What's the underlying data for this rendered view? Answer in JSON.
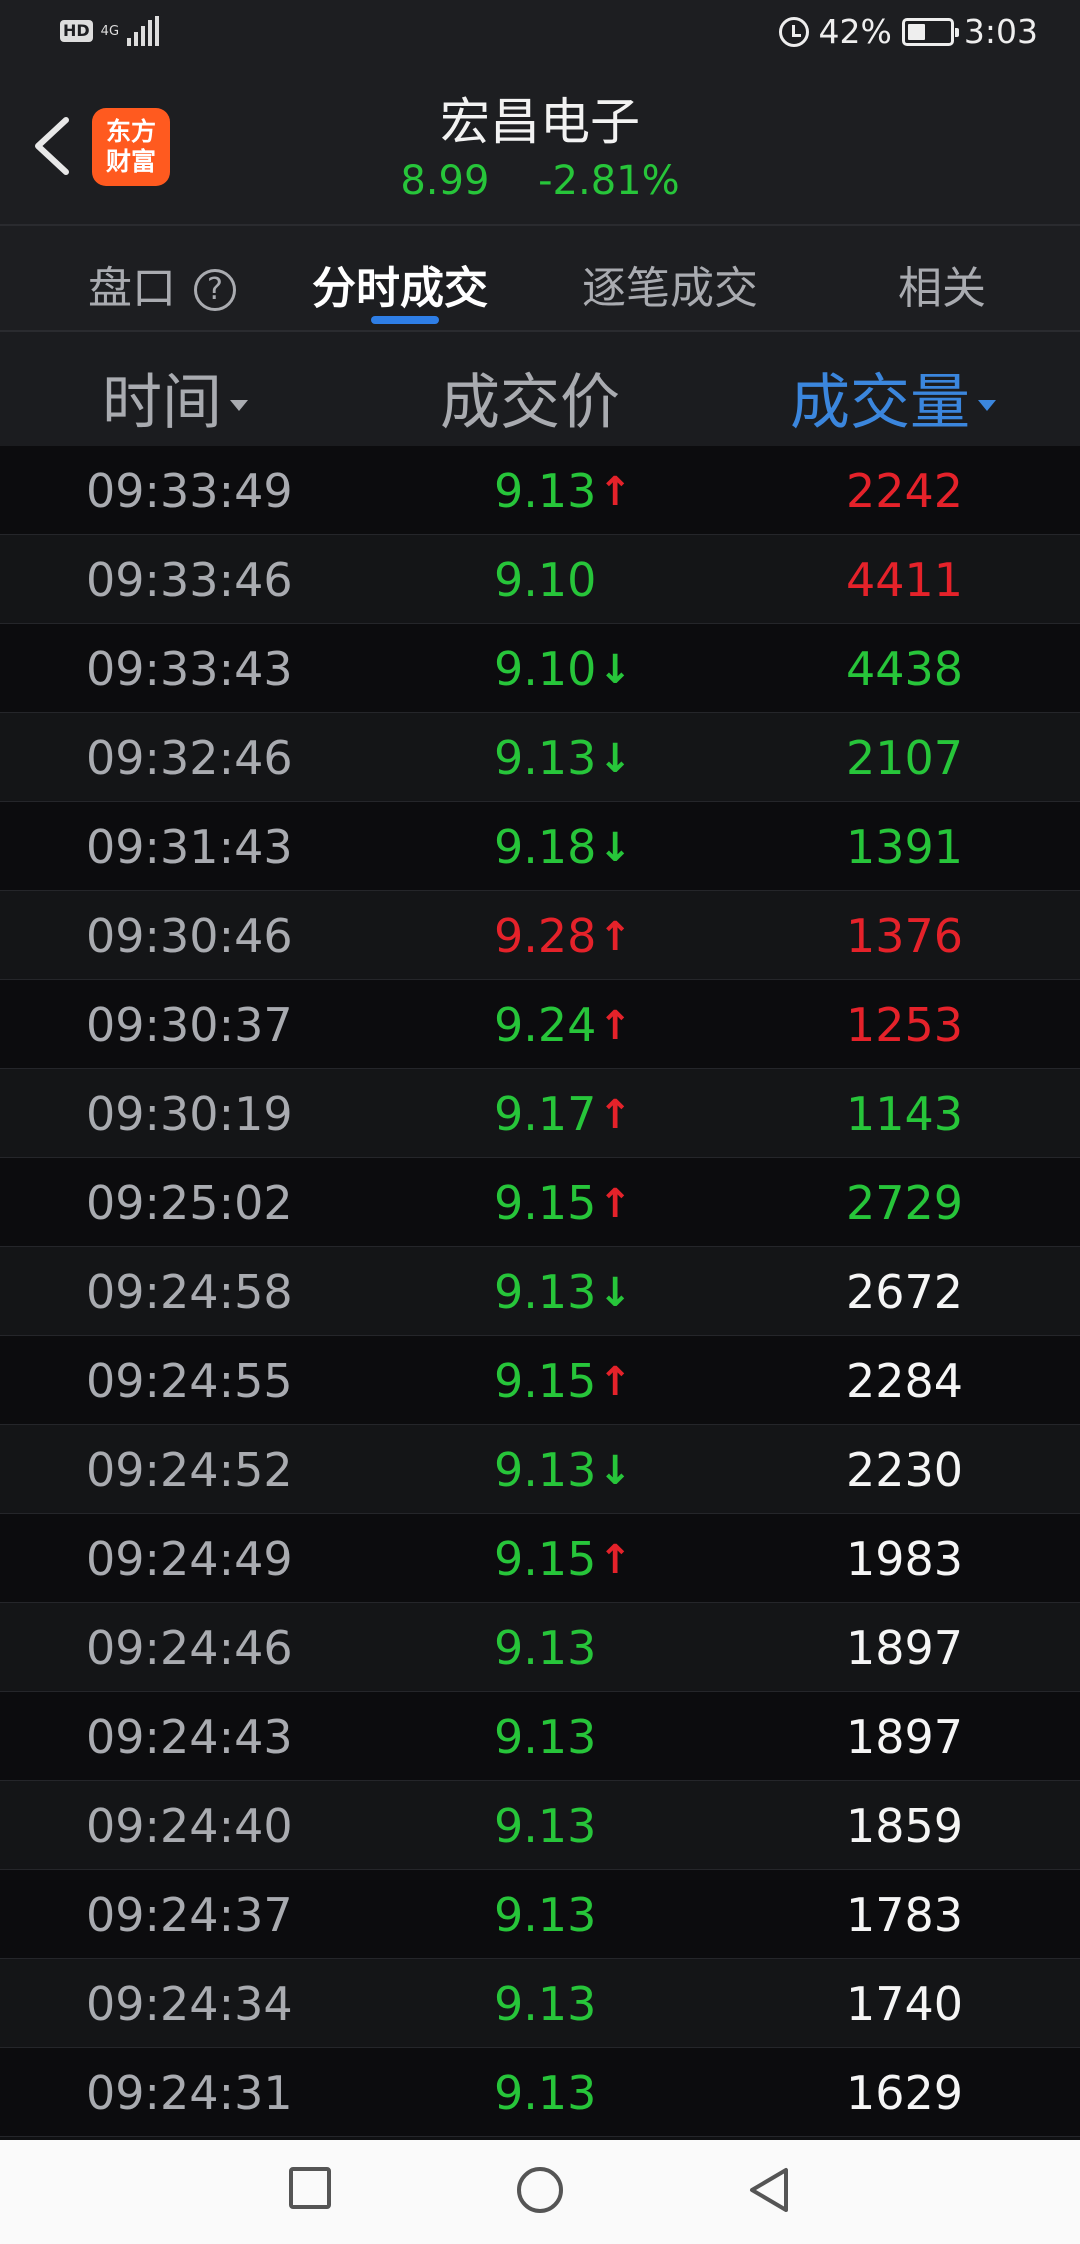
{
  "status_bar": {
    "hd": "HD",
    "network": "4G",
    "battery_percent": "42%",
    "battery_level": 0.42,
    "time": "3:03"
  },
  "header": {
    "logo_line1": "东方",
    "logo_line2": "财富",
    "stock_name": "宏昌电子",
    "price": "8.99",
    "change_percent": "-2.81%",
    "quote_color": "#27c53a"
  },
  "tabs": [
    {
      "label": "盘口",
      "active": false
    },
    {
      "label": "分时成交",
      "active": true
    },
    {
      "label": "逐笔成交",
      "active": false
    },
    {
      "label": "相关",
      "active": false
    }
  ],
  "help_symbol": "?",
  "columns": {
    "time": "时间",
    "price": "成交价",
    "volume": "成交量"
  },
  "colors": {
    "up": "#e5222a",
    "down": "#27c53a",
    "neutral": "#f5f5f5",
    "accent": "#2e7ee6"
  },
  "trades": [
    {
      "time": "09:33:49",
      "price": "9.13",
      "arrow": "up",
      "price_color": "green",
      "volume": "2242",
      "volume_color": "red"
    },
    {
      "time": "09:33:46",
      "price": "9.10",
      "arrow": "",
      "price_color": "green",
      "volume": "4411",
      "volume_color": "red"
    },
    {
      "time": "09:33:43",
      "price": "9.10",
      "arrow": "down",
      "price_color": "green",
      "volume": "4438",
      "volume_color": "green"
    },
    {
      "time": "09:32:46",
      "price": "9.13",
      "arrow": "down",
      "price_color": "green",
      "volume": "2107",
      "volume_color": "green"
    },
    {
      "time": "09:31:43",
      "price": "9.18",
      "arrow": "down",
      "price_color": "green",
      "volume": "1391",
      "volume_color": "green"
    },
    {
      "time": "09:30:46",
      "price": "9.28",
      "arrow": "up",
      "price_color": "red",
      "volume": "1376",
      "volume_color": "red"
    },
    {
      "time": "09:30:37",
      "price": "9.24",
      "arrow": "up",
      "price_color": "green",
      "volume": "1253",
      "volume_color": "red"
    },
    {
      "time": "09:30:19",
      "price": "9.17",
      "arrow": "up",
      "price_color": "green",
      "volume": "1143",
      "volume_color": "green"
    },
    {
      "time": "09:25:02",
      "price": "9.15",
      "arrow": "up",
      "price_color": "green",
      "volume": "2729",
      "volume_color": "green"
    },
    {
      "time": "09:24:58",
      "price": "9.13",
      "arrow": "down",
      "price_color": "green",
      "volume": "2672",
      "volume_color": "white"
    },
    {
      "time": "09:24:55",
      "price": "9.15",
      "arrow": "up",
      "price_color": "green",
      "volume": "2284",
      "volume_color": "white"
    },
    {
      "time": "09:24:52",
      "price": "9.13",
      "arrow": "down",
      "price_color": "green",
      "volume": "2230",
      "volume_color": "white"
    },
    {
      "time": "09:24:49",
      "price": "9.15",
      "arrow": "up",
      "price_color": "green",
      "volume": "1983",
      "volume_color": "white"
    },
    {
      "time": "09:24:46",
      "price": "9.13",
      "arrow": "",
      "price_color": "green",
      "volume": "1897",
      "volume_color": "white"
    },
    {
      "time": "09:24:43",
      "price": "9.13",
      "arrow": "",
      "price_color": "green",
      "volume": "1897",
      "volume_color": "white"
    },
    {
      "time": "09:24:40",
      "price": "9.13",
      "arrow": "",
      "price_color": "green",
      "volume": "1859",
      "volume_color": "white"
    },
    {
      "time": "09:24:37",
      "price": "9.13",
      "arrow": "",
      "price_color": "green",
      "volume": "1783",
      "volume_color": "white"
    },
    {
      "time": "09:24:34",
      "price": "9.13",
      "arrow": "",
      "price_color": "green",
      "volume": "1740",
      "volume_color": "white"
    },
    {
      "time": "09:24:31",
      "price": "9.13",
      "arrow": "",
      "price_color": "green",
      "volume": "1629",
      "volume_color": "white"
    }
  ],
  "nav_icons": [
    "recent-apps-icon",
    "home-icon",
    "back-icon"
  ]
}
